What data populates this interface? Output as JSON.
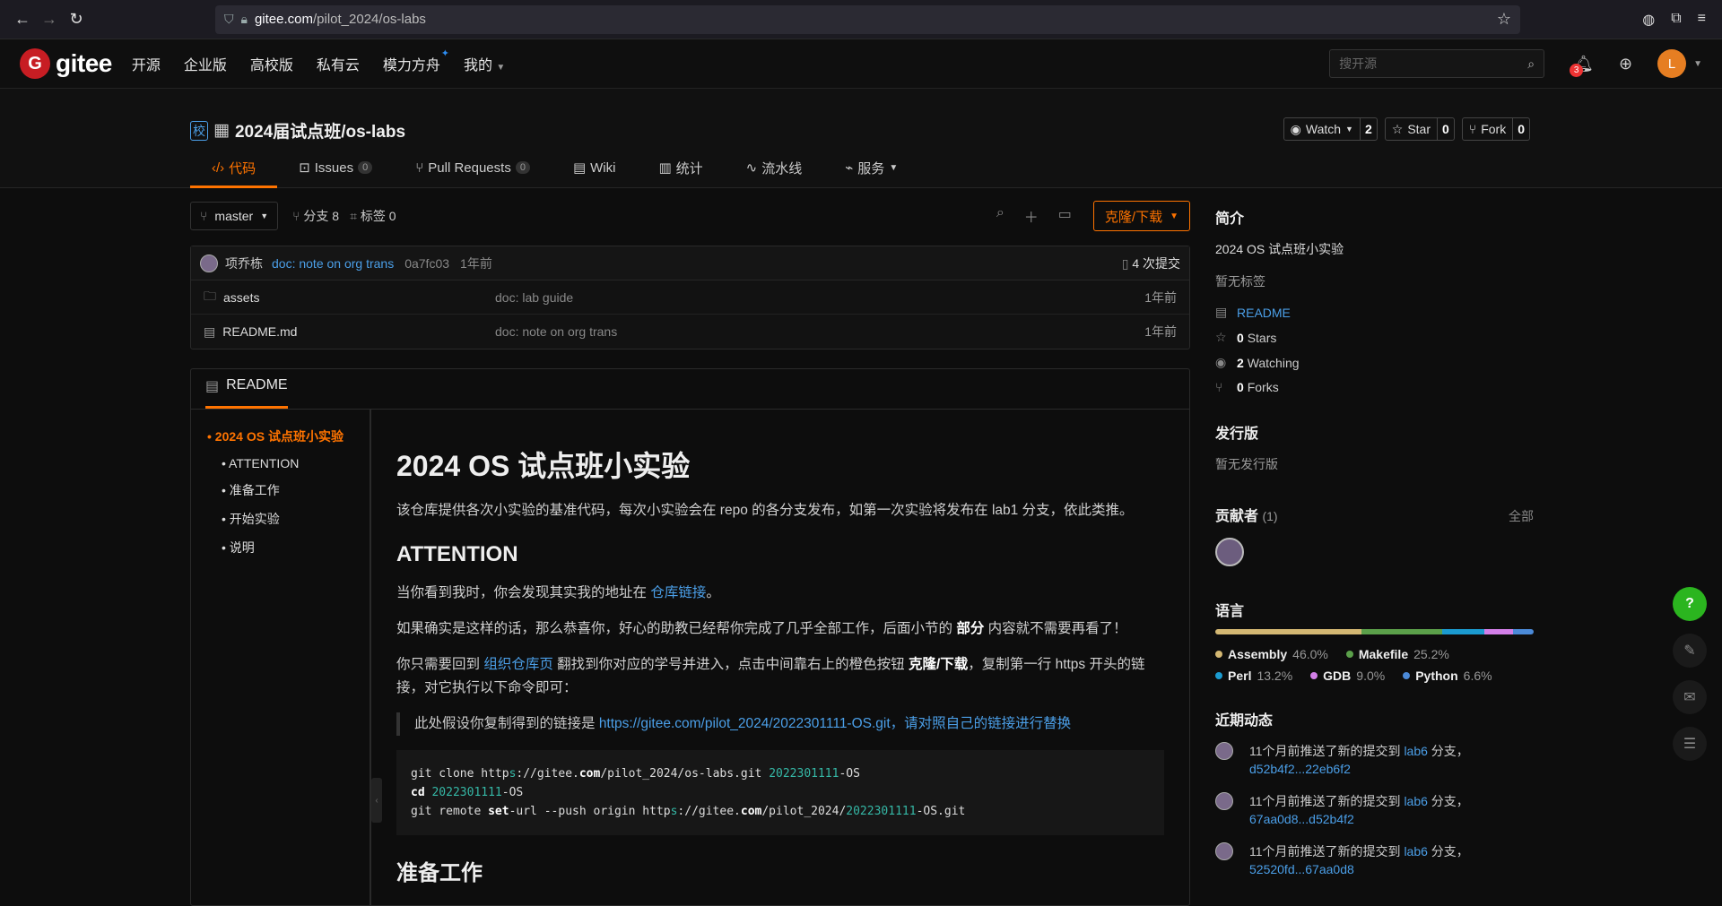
{
  "browser": {
    "url_host": "gitee.com",
    "url_path": "/pilot_2024/os-labs"
  },
  "header": {
    "logo_text": "gitee",
    "nav": [
      "开源",
      "企业版",
      "高校版",
      "私有云",
      "模力方舟",
      "我的"
    ],
    "search_placeholder": "搜开源",
    "notif_count": "3",
    "avatar_letter": "L"
  },
  "repo": {
    "badge": "校",
    "title": "2024届试点班/os-labs",
    "watch_label": "Watch",
    "watch_count": "2",
    "star_label": "Star",
    "star_count": "0",
    "fork_label": "Fork",
    "fork_count": "0",
    "tabs": [
      {
        "label": "代码"
      },
      {
        "label": "Issues",
        "count": "0"
      },
      {
        "label": "Pull Requests",
        "count": "0"
      },
      {
        "label": "Wiki"
      },
      {
        "label": "统计"
      },
      {
        "label": "流水线"
      },
      {
        "label": "服务"
      }
    ]
  },
  "toolbar": {
    "branch": "master",
    "branches": "分支 8",
    "tags": "标签 0",
    "clone_label": "克隆/下载"
  },
  "commit": {
    "author": "项乔栋",
    "message": "doc: note on org trans",
    "hash": "0a7fc03",
    "time": "1年前",
    "count": "4 次提交"
  },
  "files": [
    {
      "name": "assets",
      "msg": "doc: lab guide",
      "time": "1年前"
    },
    {
      "name": "README.md",
      "msg": "doc: note on org trans",
      "time": "1年前"
    }
  ],
  "readme": {
    "tab": "README",
    "toc": [
      "2024 OS 试点班小实验",
      "ATTENTION",
      "准备工作",
      "开始实验",
      "说明"
    ],
    "h1": "2024 OS 试点班小实验",
    "intro": "该仓库提供各次小实验的基准代码，每次小实验会在 repo 的各分支发布，如第一次实验将发布在 lab1 分支，依此类推。",
    "h2_attention": "ATTENTION",
    "p1_pre": "当你看到我时，你会发现其实我的地址在 ",
    "p1_link": "仓库链接",
    "p1_post": "。",
    "p2_pre": "如果确实是这样的话，那么恭喜你，好心的助教已经帮你完成了几乎全部工作，后面小节的 ",
    "p2_bold": "部分",
    "p2_post": " 内容就不需要再看了！",
    "p3_pre": "你只需要回到 ",
    "p3_link": "组织仓库页",
    "p3_mid": " 翻找到你对应的学号并进入，点击中间靠右上的橙色按钮 ",
    "p3_bold": "克隆/下载",
    "p3_post": "，复制第一行 https 开头的链接，对它执行以下命令即可：",
    "quote_pre": "此处假设你复制得到的链接是 ",
    "quote_link": "https://gitee.com/pilot_2024/2022301111-OS.git，请对照自己的链接进行替换",
    "h2_prep": "准备工作"
  },
  "sidebar": {
    "intro_title": "简介",
    "intro_desc": "2024 OS 试点班小实验",
    "no_tags": "暂无标签",
    "readme_link": "README",
    "stars_num": "0",
    "stars_label": "Stars",
    "watching_num": "2",
    "watching_label": "Watching",
    "forks_num": "0",
    "forks_label": "Forks",
    "release_title": "发行版",
    "no_release": "暂无发行版",
    "contrib_title": "贡献者",
    "contrib_count": "(1)",
    "contrib_all": "全部",
    "lang_title": "语言",
    "activity_title": "近期动态"
  },
  "languages": [
    {
      "name": "Assembly",
      "pct": "46.0%",
      "color": "#d4b873",
      "value": 46.0
    },
    {
      "name": "Makefile",
      "pct": "25.2%",
      "color": "#5ba04a",
      "value": 25.2
    },
    {
      "name": "Perl",
      "pct": "13.2%",
      "color": "#1b9bd0",
      "value": 13.2
    },
    {
      "name": "GDB",
      "pct": "9.0%",
      "color": "#d37fe8",
      "value": 9.0
    },
    {
      "name": "Python",
      "pct": "6.6%",
      "color": "#4b8ad8",
      "value": 6.6
    }
  ],
  "activities": [
    {
      "pre": "11个月前推送了新的提交到 ",
      "branch": "lab6",
      "mid": " 分支，",
      "range": "d52b4f2...22eb6f2"
    },
    {
      "pre": "11个月前推送了新的提交到 ",
      "branch": "lab6",
      "mid": " 分支，",
      "range": "67aa0d8...d52b4f2"
    },
    {
      "pre": "11个月前推送了新的提交到 ",
      "branch": "lab6",
      "mid": " 分支，",
      "range": "52520fd...67aa0d8"
    }
  ]
}
